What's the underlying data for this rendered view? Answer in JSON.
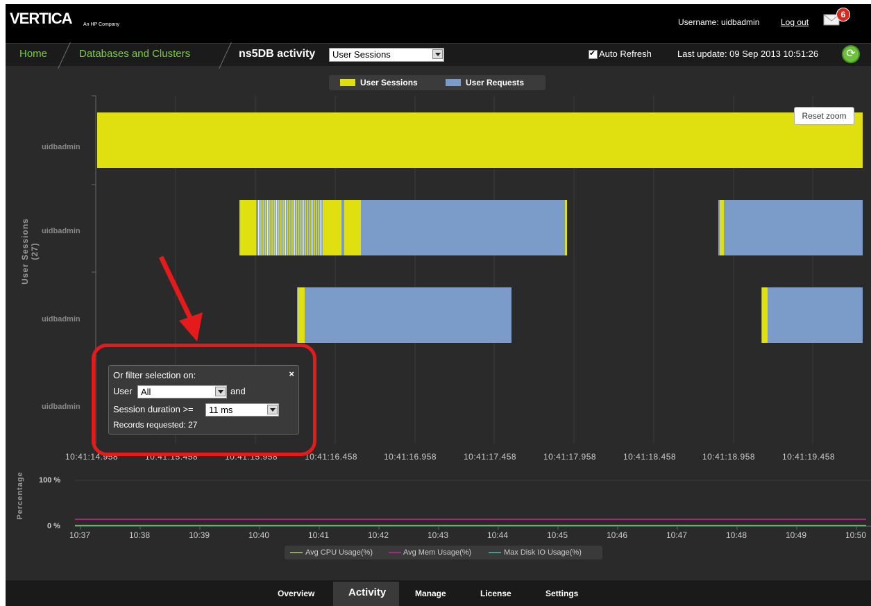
{
  "brand": {
    "logo": "VERTICA",
    "tagline": "An HP Company"
  },
  "user": {
    "username_label": "Username: uidbadmin",
    "logout": "Log out",
    "notifications": "6"
  },
  "nav": {
    "home": "Home",
    "databases": "Databases and Clusters",
    "title": "ns5DB activity",
    "view_selected": "User Sessions",
    "auto_refresh_label": "Auto Refresh",
    "auto_refresh_checked": true,
    "last_update": "Last update:  09 Sep 2013 10:51:26"
  },
  "legend": [
    {
      "label": "User Sessions",
      "color": "#e0e011"
    },
    {
      "label": "User Requests",
      "color": "#7b9cc8"
    }
  ],
  "reset_zoom": "Reset zoom",
  "y_axis_label": "User Sessions (27)",
  "row_labels": [
    "uidbadmin",
    "uidbadmin",
    "uidbadmin",
    "uidbadmin"
  ],
  "x_ticks": [
    "10:41:14.958",
    "10:41:15.458",
    "10:41:15.958",
    "10:41:16.458",
    "10:41:16.958",
    "10:41:17.458",
    "10:41:17.958",
    "10:41:18.458",
    "10:41:18.958",
    "10:41:19.458"
  ],
  "filter": {
    "title": "Or filter selection on:",
    "close": "×",
    "user_label": "User",
    "user_value": "All",
    "and_label": "and",
    "duration_label": "Session duration >=",
    "duration_value": "11 ms",
    "records": "Records requested: 27"
  },
  "lower": {
    "y_label": "Percentage",
    "y_ticks": [
      "100 %",
      "0 %"
    ],
    "x_ticks": [
      "10:37",
      "10:38",
      "10:39",
      "10:40",
      "10:41",
      "10:42",
      "10:43",
      "10:44",
      "10:45",
      "10:46",
      "10:47",
      "10:48",
      "10:49",
      "10:50"
    ],
    "legend": [
      {
        "label": "Avg CPU Usage(%)",
        "color": "#8aaa66"
      },
      {
        "label": "Avg Mem Usage(%)",
        "color": "#b0208a"
      },
      {
        "label": "Max Disk IO Usage(%)",
        "color": "#3f9f8a"
      }
    ],
    "series_levels": {
      "cpu": 0,
      "mem": 15,
      "disk": 0
    }
  },
  "tabs": [
    "Overview",
    "Activity",
    "Manage",
    "License",
    "Settings"
  ],
  "active_tab": "Activity"
}
